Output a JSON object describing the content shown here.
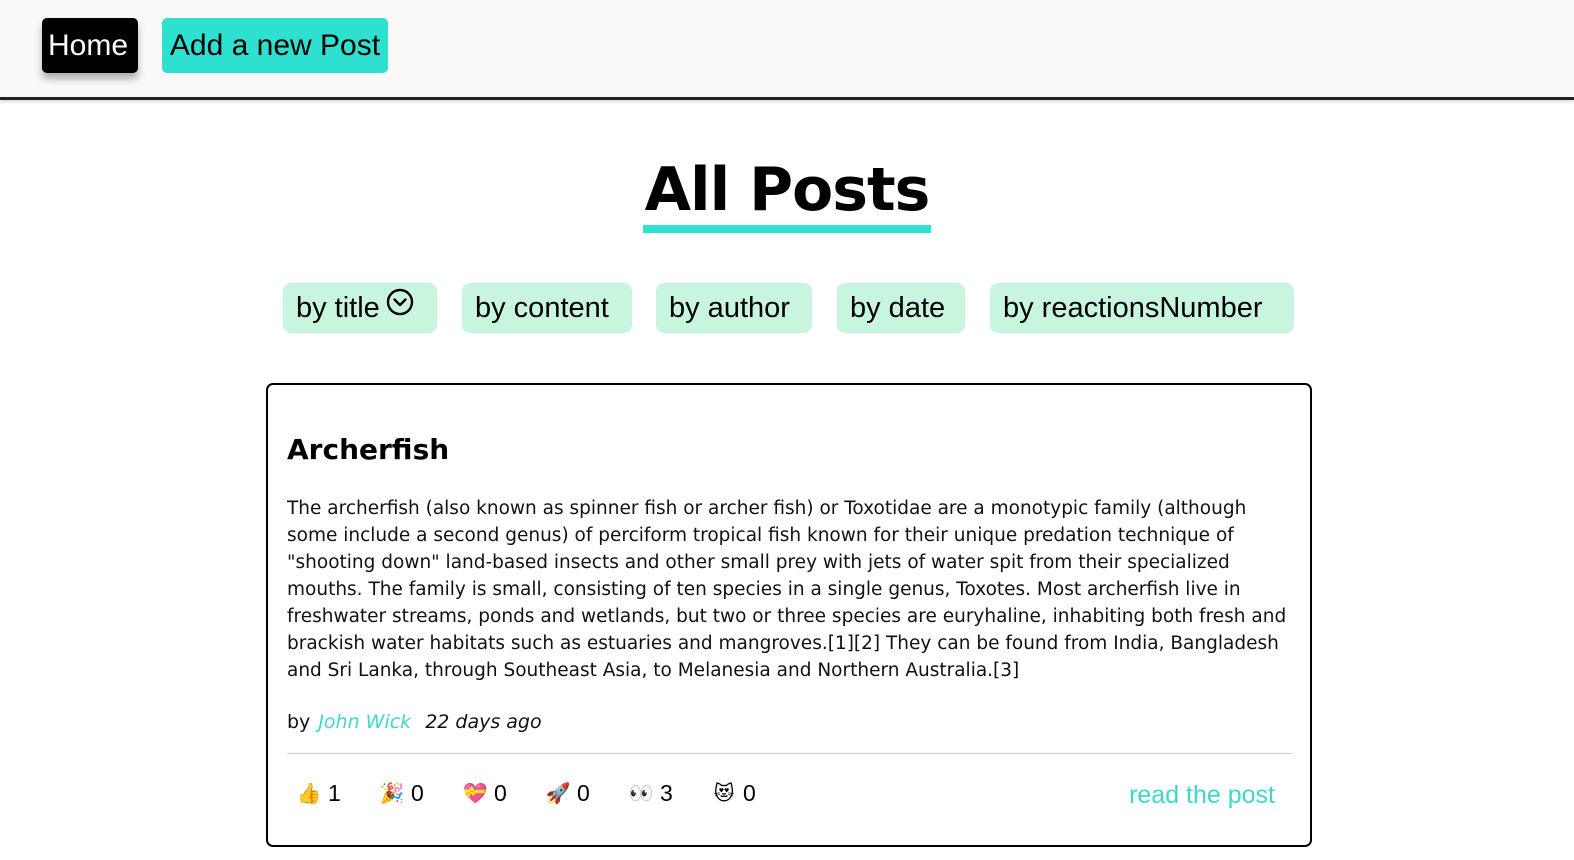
{
  "nav": {
    "home_label": "Home",
    "add_label": "Add a new Post"
  },
  "page": {
    "title": "All Posts"
  },
  "sort": {
    "buttons": [
      {
        "label": "by title",
        "icon": "chevron-down-circle-icon"
      },
      {
        "label": "by content"
      },
      {
        "label": "by author"
      },
      {
        "label": "by date"
      },
      {
        "label": "by reactionsNumber"
      }
    ]
  },
  "post": {
    "title": "Archerfish",
    "content": "The archerfish (also known as spinner fish or archer fish) or Toxotidae are a monotypic family (although some include a second genus) of perciform tropical fish known for their unique predation technique of \"shooting down\" land-based insects and other small prey with jets of water spit from their specialized mouths. The family is small, consisting of ten species in a single genus, Toxotes. Most archerfish live in freshwater streams, ponds and wetlands, but two or three species are euryhaline, inhabiting both fresh and brackish water habitats such as estuaries and mangroves.[1][2] They can be found from India, Bangladesh and Sri Lanka, through Southeast Asia, to Melanesia and Northern Australia.[3]",
    "by_label": "by",
    "author": "John Wick",
    "date": "22 days ago",
    "reactions": [
      {
        "emoji": "👍",
        "count": "1",
        "icon": "thumbs-up-icon"
      },
      {
        "emoji": "🎉",
        "count": "0",
        "icon": "party-popper-icon"
      },
      {
        "emoji": "💝",
        "count": "0",
        "icon": "heart-gift-icon"
      },
      {
        "emoji": "🚀",
        "count": "0",
        "icon": "rocket-icon"
      },
      {
        "emoji": "👀",
        "count": "3",
        "icon": "eyes-icon"
      },
      {
        "emoji": "😻",
        "count": "0",
        "icon": "heart-eyes-cat-icon"
      }
    ],
    "read_label": "read the post"
  },
  "colors": {
    "accent": "#2de0cf",
    "sort_bg": "#c8f5dd",
    "link": "#3ed8c8"
  }
}
